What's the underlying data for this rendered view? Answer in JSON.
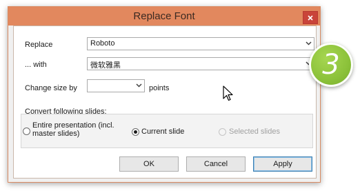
{
  "dialog": {
    "title": "Replace Font",
    "close_icon": "close-icon"
  },
  "replace": {
    "label": "Replace",
    "value": "Roboto"
  },
  "with": {
    "label": "... with",
    "value": "微软雅黑"
  },
  "size": {
    "label": "Change size by",
    "value": "",
    "units": "points"
  },
  "convert": {
    "heading": "Convert following slides:",
    "options": [
      {
        "label": "Entire presentation (incl. master slides)",
        "line1": "Entire presentation (incl.",
        "line2": "master slides)",
        "checked": false,
        "disabled": false
      },
      {
        "label": "Current slide",
        "checked": true,
        "disabled": false
      },
      {
        "label": "Selected slides",
        "checked": false,
        "disabled": true
      }
    ]
  },
  "buttons": {
    "ok": "OK",
    "cancel": "Cancel",
    "apply": "Apply"
  },
  "step_badge": "3",
  "colors": {
    "titlebar": "#e2885e",
    "close_button": "#c9443a",
    "badge": "#8cc23a",
    "default_button_border": "#3c7fb1"
  }
}
